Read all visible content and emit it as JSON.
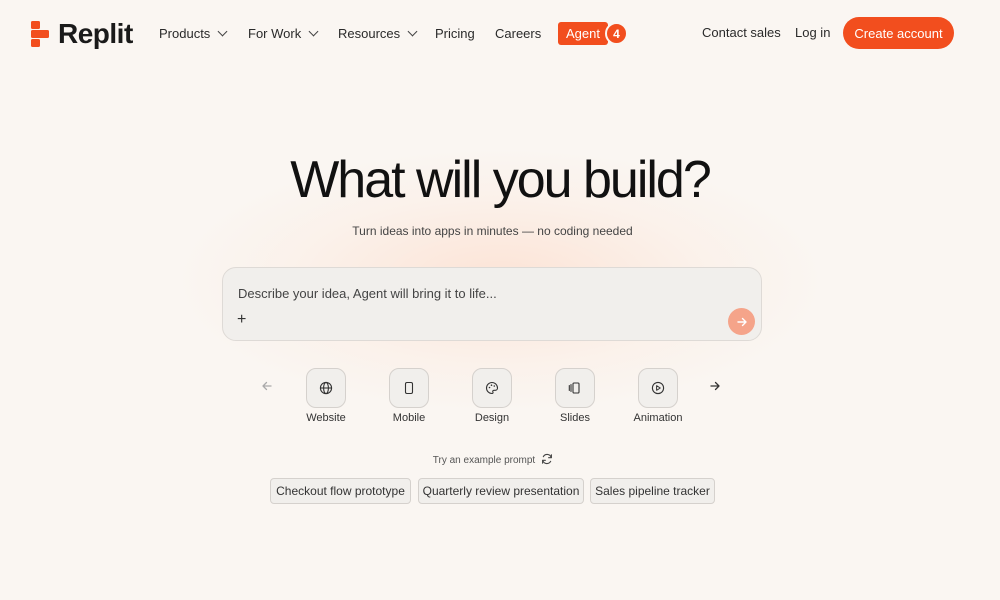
{
  "brand": {
    "name": "Replit",
    "accent": "#f24e1e"
  },
  "nav": {
    "products": "Products",
    "for_work": "For Work",
    "resources": "Resources",
    "pricing": "Pricing",
    "careers": "Careers",
    "agent": "Agent",
    "agent_badge": "4",
    "contact_sales": "Contact sales",
    "login": "Log in",
    "create_account": "Create account"
  },
  "hero": {
    "title": "What will you build?",
    "subtitle": "Turn ideas into apps in minutes — no coding needed"
  },
  "prompt": {
    "placeholder": "Describe your idea, Agent will bring it to life...",
    "value": ""
  },
  "categories": [
    {
      "label": "Website",
      "icon": "globe-icon"
    },
    {
      "label": "Mobile",
      "icon": "mobile-icon"
    },
    {
      "label": "Design",
      "icon": "palette-icon"
    },
    {
      "label": "Slides",
      "icon": "slides-icon"
    },
    {
      "label": "Animation",
      "icon": "play-icon"
    }
  ],
  "examples": {
    "label": "Try an example prompt",
    "chips": [
      "Checkout flow prototype",
      "Quarterly review presentation",
      "Sales pipeline tracker"
    ]
  }
}
